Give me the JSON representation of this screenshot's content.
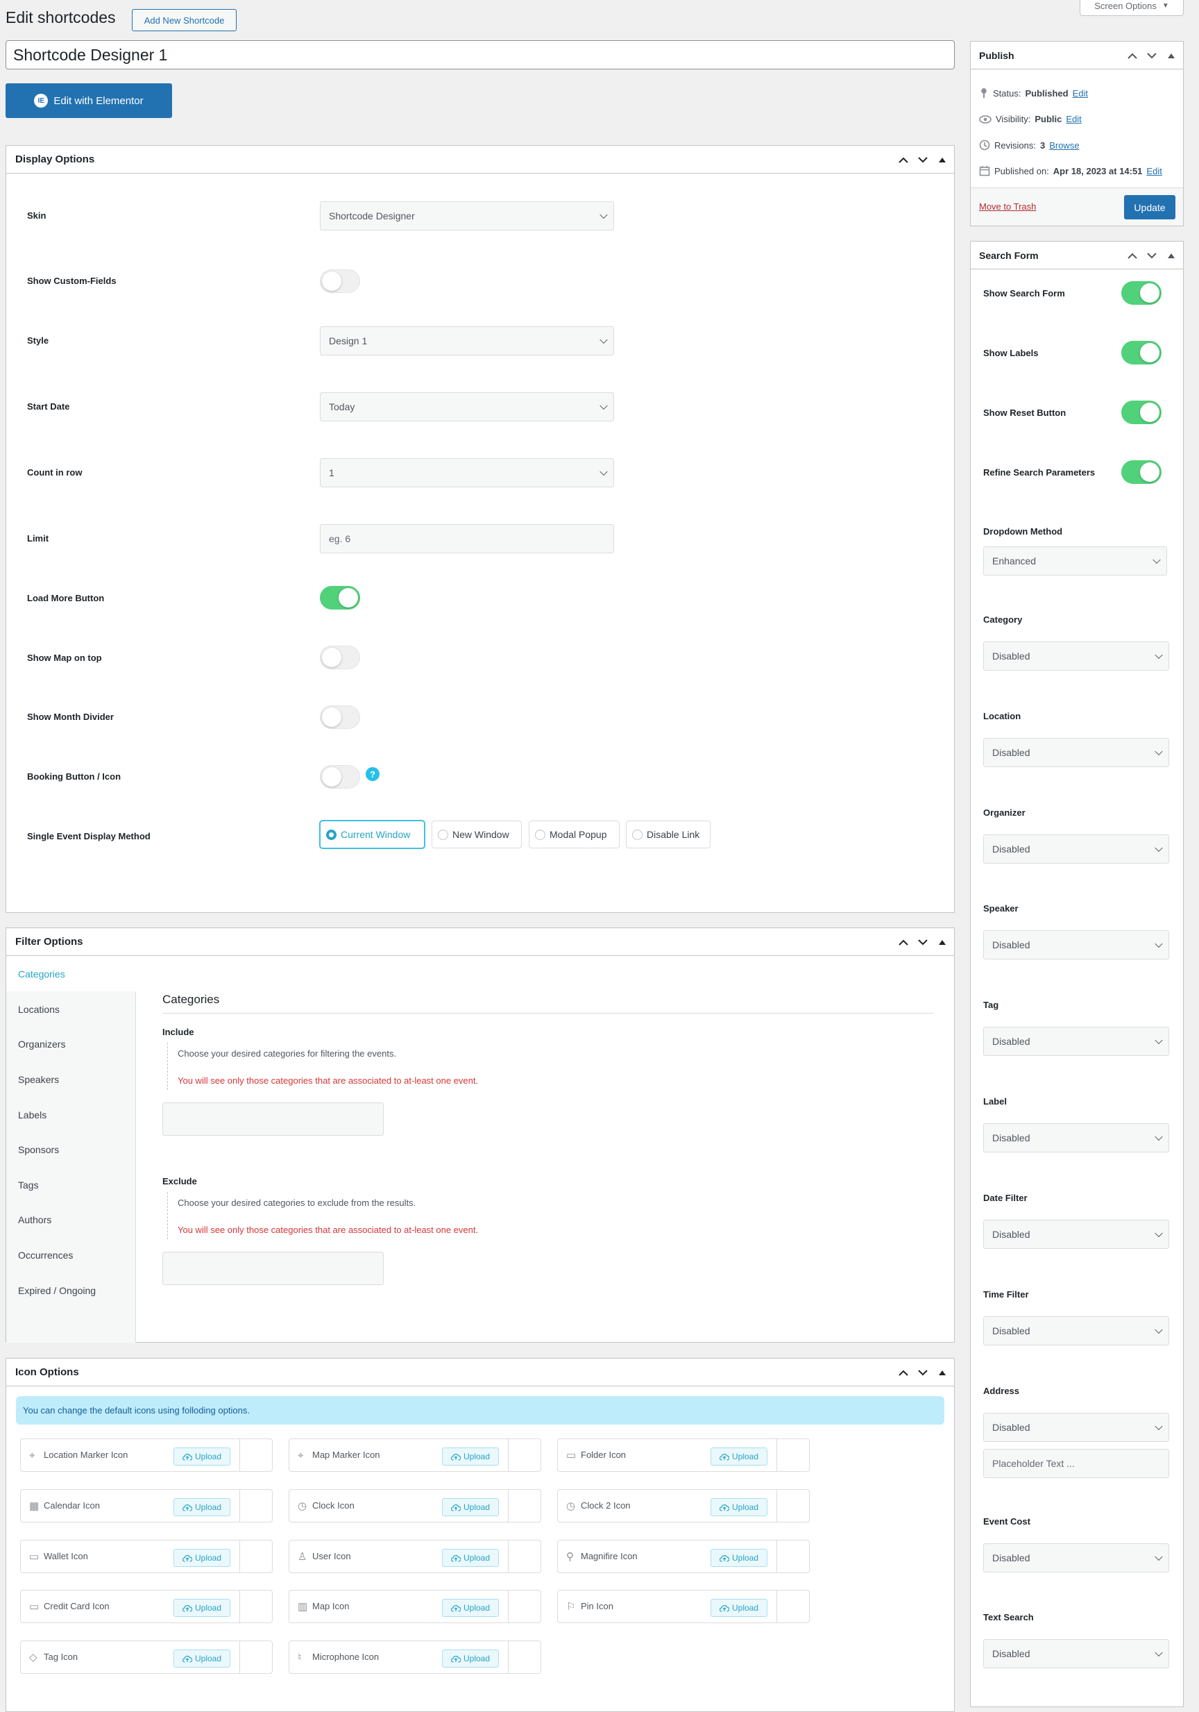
{
  "header": {
    "title": "Edit shortcodes",
    "add_new": "Add New Shortcode",
    "screen_options": "Screen Options"
  },
  "post_title": "Shortcode Designer 1",
  "elementor_button": "Edit with Elementor",
  "display_options": {
    "title": "Display Options",
    "fields": {
      "skin": {
        "label": "Skin",
        "value": "Shortcode Designer"
      },
      "custom_fields": {
        "label": "Show Custom-Fields",
        "on": false
      },
      "style": {
        "label": "Style",
        "value": "Design 1"
      },
      "start_date": {
        "label": "Start Date",
        "value": "Today"
      },
      "count": {
        "label": "Count in row",
        "value": "1"
      },
      "limit": {
        "label": "Limit",
        "placeholder": "eg. 6"
      },
      "load_more": {
        "label": "Load More Button",
        "on": true
      },
      "map_top": {
        "label": "Show Map on top",
        "on": false
      },
      "month_divider": {
        "label": "Show Month Divider",
        "on": false
      },
      "booking": {
        "label": "Booking Button / Icon",
        "on": false
      },
      "single_method": {
        "label": "Single Event Display Method"
      }
    },
    "radios": [
      "Current Window",
      "New Window",
      "Modal Popup",
      "Disable Link"
    ],
    "help_glyph": "?"
  },
  "filter_options": {
    "title": "Filter Options",
    "tabs": [
      "Categories",
      "Locations",
      "Organizers",
      "Speakers",
      "Labels",
      "Sponsors",
      "Tags",
      "Authors",
      "Occurrences",
      "Expired / Ongoing"
    ],
    "section_title": "Categories",
    "include_label": "Include",
    "include_desc": "Choose your desired categories for filtering the events.",
    "include_warn": "You will see only those categories that are associated to at-least one event.",
    "exclude_label": "Exclude",
    "exclude_desc": "Choose your desired categories to exclude from the results.",
    "exclude_warn": "You will see only those categories that are associated to at-least one event."
  },
  "icon_options": {
    "title": "Icon Options",
    "notice": "You can change the default icons using folloding options.",
    "upload_label": "Upload",
    "icons": [
      {
        "name": "Location Marker Icon",
        "icon": "location-marker-icon"
      },
      {
        "name": "Map Marker Icon",
        "icon": "map-marker-icon"
      },
      {
        "name": "Folder Icon",
        "icon": "folder-icon"
      },
      {
        "name": "Calendar Icon",
        "icon": "calendar-icon"
      },
      {
        "name": "Clock Icon",
        "icon": "clock-icon"
      },
      {
        "name": "Clock 2 Icon",
        "icon": "clock-2-icon"
      },
      {
        "name": "Wallet Icon",
        "icon": "wallet-icon"
      },
      {
        "name": "User Icon",
        "icon": "user-icon"
      },
      {
        "name": "Magnifire Icon",
        "icon": "magnifier-icon"
      },
      {
        "name": "Credit Card Icon",
        "icon": "credit-card-icon"
      },
      {
        "name": "Map Icon",
        "icon": "map-icon"
      },
      {
        "name": "Pin Icon",
        "icon": "pin-icon"
      },
      {
        "name": "Tag Icon",
        "icon": "tag-icon"
      },
      {
        "name": "Microphone Icon",
        "icon": "microphone-icon"
      }
    ]
  },
  "publish": {
    "title": "Publish",
    "status_label": "Status:",
    "status_value": "Published",
    "visibility_label": "Visibility:",
    "visibility_value": "Public",
    "revisions_label": "Revisions:",
    "revisions_value": "3",
    "browse": "Browse",
    "published_label": "Published on:",
    "published_value": "Apr 18, 2023 at 14:51",
    "edit": "Edit",
    "trash": "Move to Trash",
    "update": "Update"
  },
  "search_form": {
    "title": "Search Form",
    "toggles": [
      {
        "label": "Show Search Form",
        "on": true
      },
      {
        "label": "Show Labels",
        "on": true
      },
      {
        "label": "Show Reset Button",
        "on": true
      },
      {
        "label": "Refine Search Parameters",
        "on": true
      }
    ],
    "dropdown_method": {
      "label": "Dropdown Method",
      "value": "Enhanced"
    },
    "filters": [
      {
        "label": "Category",
        "value": "Disabled"
      },
      {
        "label": "Location",
        "value": "Disabled"
      },
      {
        "label": "Organizer",
        "value": "Disabled"
      },
      {
        "label": "Speaker",
        "value": "Disabled"
      },
      {
        "label": "Tag",
        "value": "Disabled"
      },
      {
        "label": "Label",
        "value": "Disabled"
      },
      {
        "label": "Date Filter",
        "value": "Disabled"
      },
      {
        "label": "Time Filter",
        "value": "Disabled"
      },
      {
        "label": "Address",
        "value": "Disabled"
      },
      {
        "label": "Event Cost",
        "value": "Disabled"
      },
      {
        "label": "Text Search",
        "value": "Disabled"
      }
    ],
    "address_placeholder": "Placeholder Text ..."
  },
  "colors": {
    "accent": "#2271b1",
    "toggle_on": "#51d17a",
    "notice_bg": "#bfecfb",
    "warn": "#d63638"
  }
}
